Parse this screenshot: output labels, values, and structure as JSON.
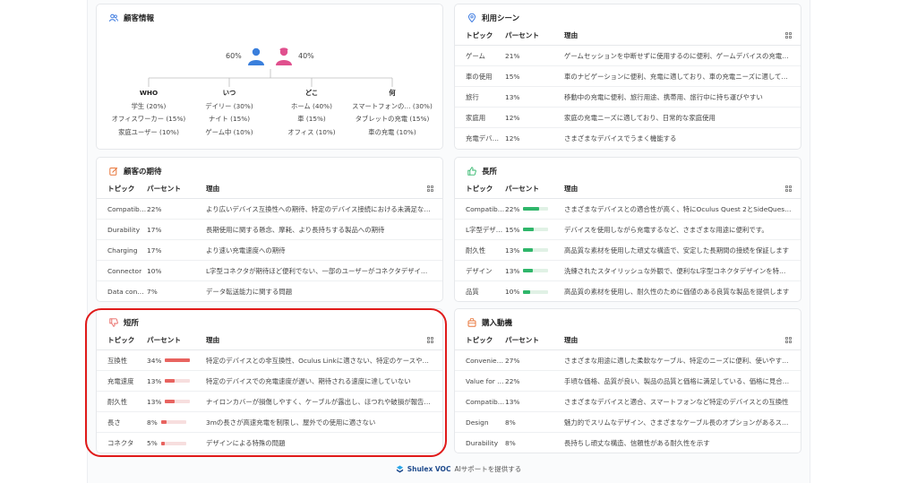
{
  "customer_info": {
    "title": "顧客情報",
    "male_percent": "60%",
    "female_percent": "40%",
    "columns": [
      {
        "header": "WHO",
        "items": [
          "学生 (20%)",
          "オフィスワーカー (15%)",
          "家庭ユーザー (10%)"
        ]
      },
      {
        "header": "いつ",
        "items": [
          "デイリー (30%)",
          "ナイト (15%)",
          "ゲーム中 (10%)"
        ]
      },
      {
        "header": "どこ",
        "items": [
          "ホーム (40%)",
          "車 (15%)",
          "オフィス (10%)"
        ]
      },
      {
        "header": "何",
        "items": [
          "スマートフォンの… (30%)",
          "タブレットの充電 (15%)",
          "車の充電 (10%)"
        ]
      }
    ]
  },
  "usage_scenes": {
    "title": "利用シーン",
    "headers": [
      "トピック",
      "パーセント",
      "理由"
    ],
    "rows": [
      {
        "topic": "ゲーム",
        "percent": "21%",
        "reason": "ゲームセッションを中断せずに使用するのに便利、ゲームデバイスの充電に最適"
      },
      {
        "topic": "車の使用",
        "percent": "15%",
        "reason": "車のナビゲーションに便利、充電に適しており、車の充電ニーズに適している"
      },
      {
        "topic": "旅行",
        "percent": "13%",
        "reason": "移動中の充電に便利、旅行用途、携帯用、旅行中に持ち運びやすい"
      },
      {
        "topic": "家庭用",
        "percent": "12%",
        "reason": "家庭の充電ニーズに適しており、日常的な家庭使用"
      },
      {
        "topic": "充電デバイス",
        "percent": "12%",
        "reason": "さまざまなデバイスでうまく機能する"
      }
    ]
  },
  "expectations": {
    "title": "顧客の期待",
    "headers": [
      "トピック",
      "パーセント",
      "理由"
    ],
    "rows": [
      {
        "topic": "Compatibility",
        "percent": "22%",
        "reason": "より広いデバイス互換性への期待、特定のデバイス接続における未満足な結果"
      },
      {
        "topic": "Durability",
        "percent": "17%",
        "reason": "長期使用に関する懸念、摩耗、より長持ちする製品への期待"
      },
      {
        "topic": "Charging",
        "percent": "17%",
        "reason": "より速い充電速度への期待"
      },
      {
        "topic": "Connector",
        "percent": "10%",
        "reason": "L字型コネクタが期待ほど便利でない、一部のユーザーがコネクタデザインに不満"
      },
      {
        "topic": "Data connection",
        "percent": "7%",
        "reason": "データ転送能力に関する問題"
      }
    ]
  },
  "strengths": {
    "title": "長所",
    "headers": [
      "トピック",
      "パーセント",
      "理由"
    ],
    "rows": [
      {
        "topic": "Compatibility",
        "percent": "22%",
        "value": 0.22,
        "reason": "さまざまなデバイスとの適合性が高く、特にOculus Quest 2とSideQuestに対応"
      },
      {
        "topic": "L字型デザイン",
        "percent": "15%",
        "value": 0.15,
        "reason": "デバイスを使用しながら充電するなど、さまざまな用途に便利です。"
      },
      {
        "topic": "耐久性",
        "percent": "13%",
        "value": 0.13,
        "reason": "高品質な素材を使用した頑丈な構造で、安定した長期間の接続を保証します"
      },
      {
        "topic": "デザイン",
        "percent": "13%",
        "value": 0.13,
        "reason": "洗練されたスタイリッシュな外観で、便利なL字型コネクタデザインを特徴としています"
      },
      {
        "topic": "品質",
        "percent": "10%",
        "value": 0.1,
        "reason": "高品質の素材を使用し、耐久性のために価値のある良質な製品を提供します"
      }
    ]
  },
  "weaknesses": {
    "title": "短所",
    "headers": [
      "トピック",
      "パーセント",
      "理由"
    ],
    "rows": [
      {
        "topic": "互換性",
        "percent": "34%",
        "value": 0.34,
        "reason": "特定のデバイスとの非互換性、Oculus Linkに適さない、特定のケースやデバイスで動作しない"
      },
      {
        "topic": "充電速度",
        "percent": "13%",
        "value": 0.13,
        "reason": "特定のデバイスでの充電速度が遅い、期待される速度に達していない"
      },
      {
        "topic": "耐久性",
        "percent": "13%",
        "value": 0.13,
        "reason": "ナイロンカバーが損傷しやすく、ケーブルが露出し、ほつれや破損が報告されている"
      },
      {
        "topic": "長さ",
        "percent": "8%",
        "value": 0.08,
        "reason": "3mの長さが高速充電を制限し、屋外での使用に適さない"
      },
      {
        "topic": "コネクタ",
        "percent": "5%",
        "value": 0.05,
        "reason": "デザインによる特殊の問題"
      }
    ]
  },
  "purchase_motivation": {
    "title": "購入動機",
    "headers": [
      "トピック",
      "パーセント",
      "理由"
    ],
    "rows": [
      {
        "topic": "Convenience",
        "percent": "27%",
        "reason": "さまざまな用途に適した柔軟なケーブル、特定のニーズに便利、使いやすいデザイン"
      },
      {
        "topic": "Value for money",
        "percent": "22%",
        "reason": "手頃な価格、品質が良い、製品の品質と価格に満足している、価格に見合った価値"
      },
      {
        "topic": "Compatibility",
        "percent": "13%",
        "reason": "さまざまなデバイスと適合、スマートフォンなど特定のデバイスとの互換性"
      },
      {
        "topic": "Design",
        "percent": "8%",
        "reason": "魅力的でスリムなデザイン、さまざまなケーブル長のオプションがあるスタイル"
      },
      {
        "topic": "Durability",
        "percent": "8%",
        "reason": "長持ちし頑丈な構造、信頼性がある耐久性を示す"
      }
    ]
  },
  "footer": {
    "brand": "Shulex VOC",
    "text": "AIサポートを提供する"
  },
  "colors": {
    "accent_blue": "#3d7be0",
    "male_blue": "#3a7fdc",
    "female_pink": "#e0508e",
    "weak_red": "#e8635f",
    "strong_green": "#2fb66a",
    "highlight_red": "#e01a1a"
  }
}
